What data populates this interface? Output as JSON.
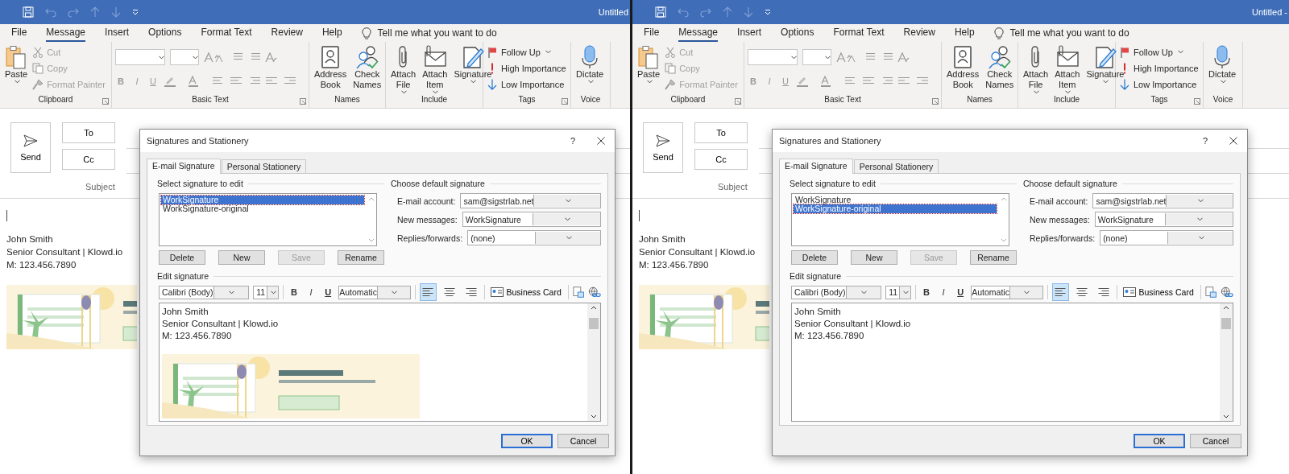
{
  "panes": [
    {
      "window_title": "Untitled",
      "ribbon_tabs": [
        {
          "label": "File",
          "selected": false
        },
        {
          "label": "Message",
          "selected": true
        },
        {
          "label": "Insert",
          "selected": false
        },
        {
          "label": "Options",
          "selected": false
        },
        {
          "label": "Format Text",
          "selected": false
        },
        {
          "label": "Review",
          "selected": false
        },
        {
          "label": "Help",
          "selected": false
        }
      ],
      "tell_me": "Tell me what you want to do",
      "ribbon_groups": [
        {
          "label": "Clipboard",
          "launcher": true,
          "items": [
            {
              "kind": "large",
              "label": "Paste",
              "caret": true,
              "disabled": false
            },
            {
              "kind": "small",
              "label": "Cut",
              "caret": false,
              "disabled": true
            },
            {
              "kind": "small",
              "label": "Copy",
              "caret": false,
              "disabled": true
            },
            {
              "kind": "small",
              "label": "Format Painter",
              "caret": false,
              "disabled": true
            }
          ]
        },
        {
          "label": "Basic Text",
          "launcher": true,
          "kind": "basic",
          "format_buttons": [
            "B",
            "I",
            "U"
          ]
        },
        {
          "label": "Names",
          "launcher": false,
          "items": [
            {
              "kind": "large",
              "label": "Address Book",
              "caret": false,
              "disabled": false
            },
            {
              "kind": "large",
              "label": "Check Names",
              "caret": false,
              "disabled": false
            }
          ]
        },
        {
          "label": "Include",
          "launcher": false,
          "items": [
            {
              "kind": "large",
              "label": "Attach File",
              "caret": true,
              "disabled": false
            },
            {
              "kind": "large",
              "label": "Attach Item",
              "caret": true,
              "disabled": false
            },
            {
              "kind": "large",
              "label": "Signature",
              "caret": true,
              "disabled": false
            }
          ]
        },
        {
          "label": "Tags",
          "launcher": true,
          "items": [
            {
              "kind": "small",
              "label": "Follow Up",
              "caret": true,
              "disabled": false
            },
            {
              "kind": "small",
              "label": "High Importance",
              "caret": false,
              "disabled": false
            },
            {
              "kind": "small",
              "label": "Low Importance",
              "caret": false,
              "disabled": false
            }
          ]
        },
        {
          "label": "Voice",
          "launcher": false,
          "items": [
            {
              "kind": "large",
              "label": "Dictate",
              "caret": true,
              "disabled": false
            }
          ]
        }
      ],
      "compose": {
        "send": "Send",
        "to": "To",
        "cc": "Cc",
        "subject": "Subject",
        "body": [
          "John Smith",
          "Senior Consultant | Klowd.io",
          "M: 123.456.7890"
        ],
        "image": {
          "kind": "picture"
        }
      },
      "dialog": {
        "title": "Signatures and Stationery",
        "help": "?",
        "tabs": [
          {
            "label": "E-mail Signature",
            "selected": true
          },
          {
            "label": "Personal Stationery",
            "selected": false
          }
        ],
        "select_heading": "Select signature to edit",
        "signatures": [
          {
            "label": "WorkSignature",
            "selected": true
          },
          {
            "label": "WorkSignature-original",
            "selected": false
          }
        ],
        "list_buttons": [
          {
            "label": "Delete",
            "disabled": false
          },
          {
            "label": "New",
            "disabled": false
          },
          {
            "label": "Save",
            "disabled": true
          },
          {
            "label": "Rename",
            "disabled": false
          }
        ],
        "default_heading": "Choose default signature",
        "defaults": [
          {
            "label": "E-mail account:",
            "value": "sam@sigstrlab.net"
          },
          {
            "label": "New messages:",
            "value": "WorkSignature"
          },
          {
            "label": "Replies/forwards:",
            "value": "(none)"
          }
        ],
        "edit_heading": "Edit signature",
        "font": "Calibri (Body)",
        "size": "11",
        "format_buttons": [
          "B",
          "I",
          "U"
        ],
        "font_color": "Automatic",
        "align": [
          {
            "selected": true
          },
          {
            "selected": false
          },
          {
            "selected": false
          }
        ],
        "business_card": "Business Card",
        "editor": {
          "lines": [
            "John Smith",
            "Senior Consultant | Klowd.io",
            "M: 123.456.7890"
          ],
          "image": {
            "kind": "picture"
          }
        },
        "ok": "OK",
        "cancel": "Cancel"
      }
    },
    {
      "window_title": "Untitled -",
      "ribbon_tabs": [
        {
          "label": "File",
          "selected": false
        },
        {
          "label": "Message",
          "selected": true
        },
        {
          "label": "Insert",
          "selected": false
        },
        {
          "label": "Options",
          "selected": false
        },
        {
          "label": "Format Text",
          "selected": false
        },
        {
          "label": "Review",
          "selected": false
        },
        {
          "label": "Help",
          "selected": false
        }
      ],
      "tell_me": "Tell me what you want to do",
      "ribbon_groups": [
        {
          "label": "Clipboard",
          "launcher": true,
          "items": [
            {
              "kind": "large",
              "label": "Paste",
              "caret": true,
              "disabled": false
            },
            {
              "kind": "small",
              "label": "Cut",
              "caret": false,
              "disabled": true
            },
            {
              "kind": "small",
              "label": "Copy",
              "caret": false,
              "disabled": true
            },
            {
              "kind": "small",
              "label": "Format Painter",
              "caret": false,
              "disabled": true
            }
          ]
        },
        {
          "label": "Basic Text",
          "launcher": true,
          "kind": "basic",
          "format_buttons": [
            "B",
            "I",
            "U"
          ]
        },
        {
          "label": "Names",
          "launcher": false,
          "items": [
            {
              "kind": "large",
              "label": "Address Book",
              "caret": false,
              "disabled": false
            },
            {
              "kind": "large",
              "label": "Check Names",
              "caret": false,
              "disabled": false
            }
          ]
        },
        {
          "label": "Include",
          "launcher": false,
          "items": [
            {
              "kind": "large",
              "label": "Attach File",
              "caret": true,
              "disabled": false
            },
            {
              "kind": "large",
              "label": "Attach Item",
              "caret": true,
              "disabled": false
            },
            {
              "kind": "large",
              "label": "Signature",
              "caret": true,
              "disabled": false
            }
          ]
        },
        {
          "label": "Tags",
          "launcher": true,
          "items": [
            {
              "kind": "small",
              "label": "Follow Up",
              "caret": true,
              "disabled": false
            },
            {
              "kind": "small",
              "label": "High Importance",
              "caret": false,
              "disabled": false
            },
            {
              "kind": "small",
              "label": "Low Importance",
              "caret": false,
              "disabled": false
            }
          ]
        },
        {
          "label": "Voice",
          "launcher": false,
          "items": [
            {
              "kind": "large",
              "label": "Dictate",
              "caret": true,
              "disabled": false
            }
          ]
        }
      ],
      "compose": {
        "send": "Send",
        "to": "To",
        "cc": "Cc",
        "subject": "Subject",
        "body": [
          "John Smith",
          "Senior Consultant | Klowd.io",
          "M: 123.456.7890"
        ],
        "image": {
          "kind": "picture"
        }
      },
      "dialog": {
        "title": "Signatures and Stationery",
        "help": "?",
        "tabs": [
          {
            "label": "E-mail Signature",
            "selected": true
          },
          {
            "label": "Personal Stationery",
            "selected": false
          }
        ],
        "select_heading": "Select signature to edit",
        "signatures": [
          {
            "label": "WorkSignature",
            "selected": false
          },
          {
            "label": "WorkSignature-original",
            "selected": true
          }
        ],
        "list_buttons": [
          {
            "label": "Delete",
            "disabled": false
          },
          {
            "label": "New",
            "disabled": false
          },
          {
            "label": "Save",
            "disabled": true
          },
          {
            "label": "Rename",
            "disabled": false
          }
        ],
        "default_heading": "Choose default signature",
        "defaults": [
          {
            "label": "E-mail account:",
            "value": "sam@sigstrlab.net"
          },
          {
            "label": "New messages:",
            "value": "WorkSignature"
          },
          {
            "label": "Replies/forwards:",
            "value": "(none)"
          }
        ],
        "edit_heading": "Edit signature",
        "font": "Calibri (Body)",
        "size": "11",
        "format_buttons": [
          "B",
          "I",
          "U"
        ],
        "font_color": "Automatic",
        "align": [
          {
            "selected": true
          },
          {
            "selected": false
          },
          {
            "selected": false
          }
        ],
        "business_card": "Business Card",
        "editor": {
          "lines": [
            "John Smith",
            "Senior Consultant | Klowd.io",
            "M: 123.456.7890"
          ]
        },
        "ok": "OK",
        "cancel": "Cancel"
      }
    }
  ]
}
